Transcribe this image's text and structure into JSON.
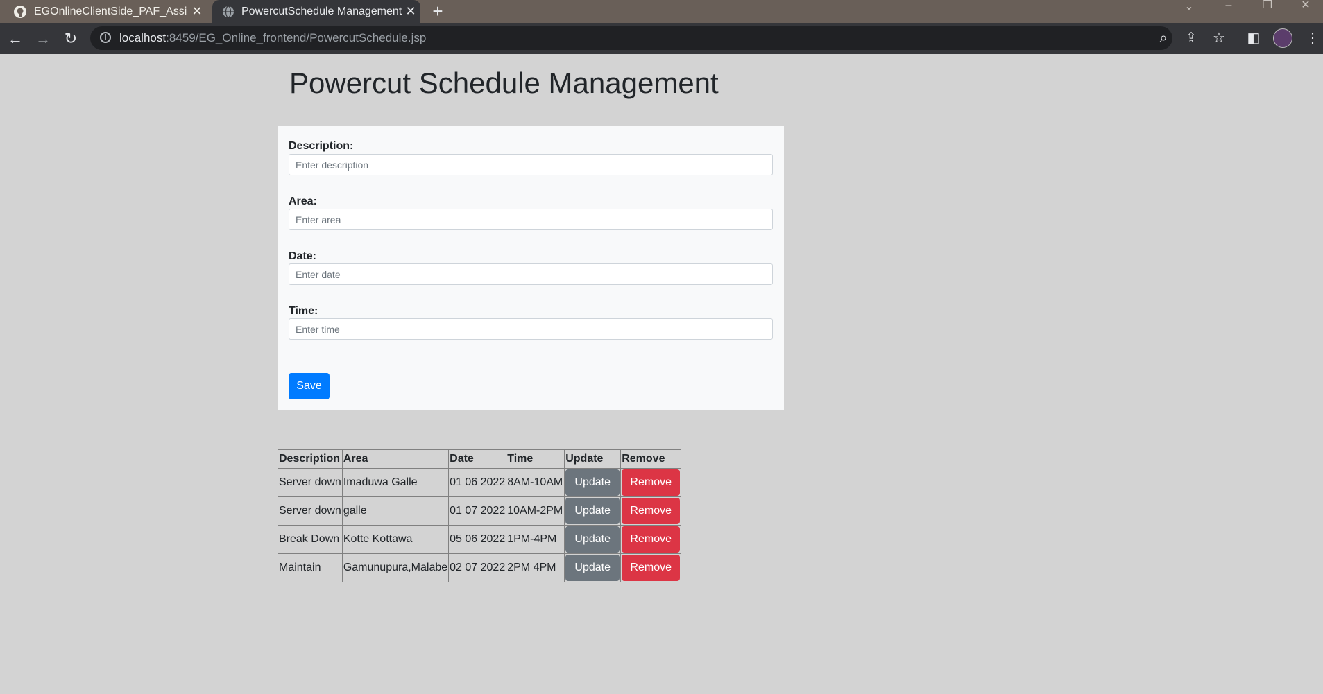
{
  "browser": {
    "tabs": [
      {
        "title": "EGOnlineClientSide_PAF_Assignm",
        "icon": "github-icon"
      },
      {
        "title": "PowercutSchedule Management",
        "icon": "globe-icon"
      }
    ],
    "url_host": "localhost",
    "url_rest": ":8459/EG_Online_frontend/PowercutSchedule.jsp"
  },
  "page": {
    "title": "Powercut Schedule Management"
  },
  "form": {
    "description_label": "Description:",
    "description_placeholder": "Enter description",
    "area_label": "Area:",
    "area_placeholder": "Enter area",
    "date_label": "Date:",
    "date_placeholder": "Enter date",
    "time_label": "Time:",
    "time_placeholder": "Enter time",
    "save_label": "Save"
  },
  "table": {
    "headers": [
      "Description",
      "Area",
      "Date",
      "Time",
      "Update",
      "Remove"
    ],
    "update_label": "Update",
    "remove_label": "Remove",
    "rows": [
      {
        "description": "Server down",
        "area": "Imaduwa Galle",
        "date": "01 06 2022",
        "time": "8AM-10AM"
      },
      {
        "description": "Server down",
        "area": "galle",
        "date": "01 07 2022",
        "time": "10AM-2PM"
      },
      {
        "description": "Break Down",
        "area": "Kotte Kottawa",
        "date": "05 06 2022",
        "time": "1PM-4PM"
      },
      {
        "description": "Maintain",
        "area": "Gamunupura,Malabe",
        "date": "02 07 2022",
        "time": "2PM 4PM"
      }
    ]
  },
  "colors": {
    "save": "#007bff",
    "update": "#6c757d",
    "remove": "#dc3545",
    "page_bg": "#d3d3d3"
  }
}
